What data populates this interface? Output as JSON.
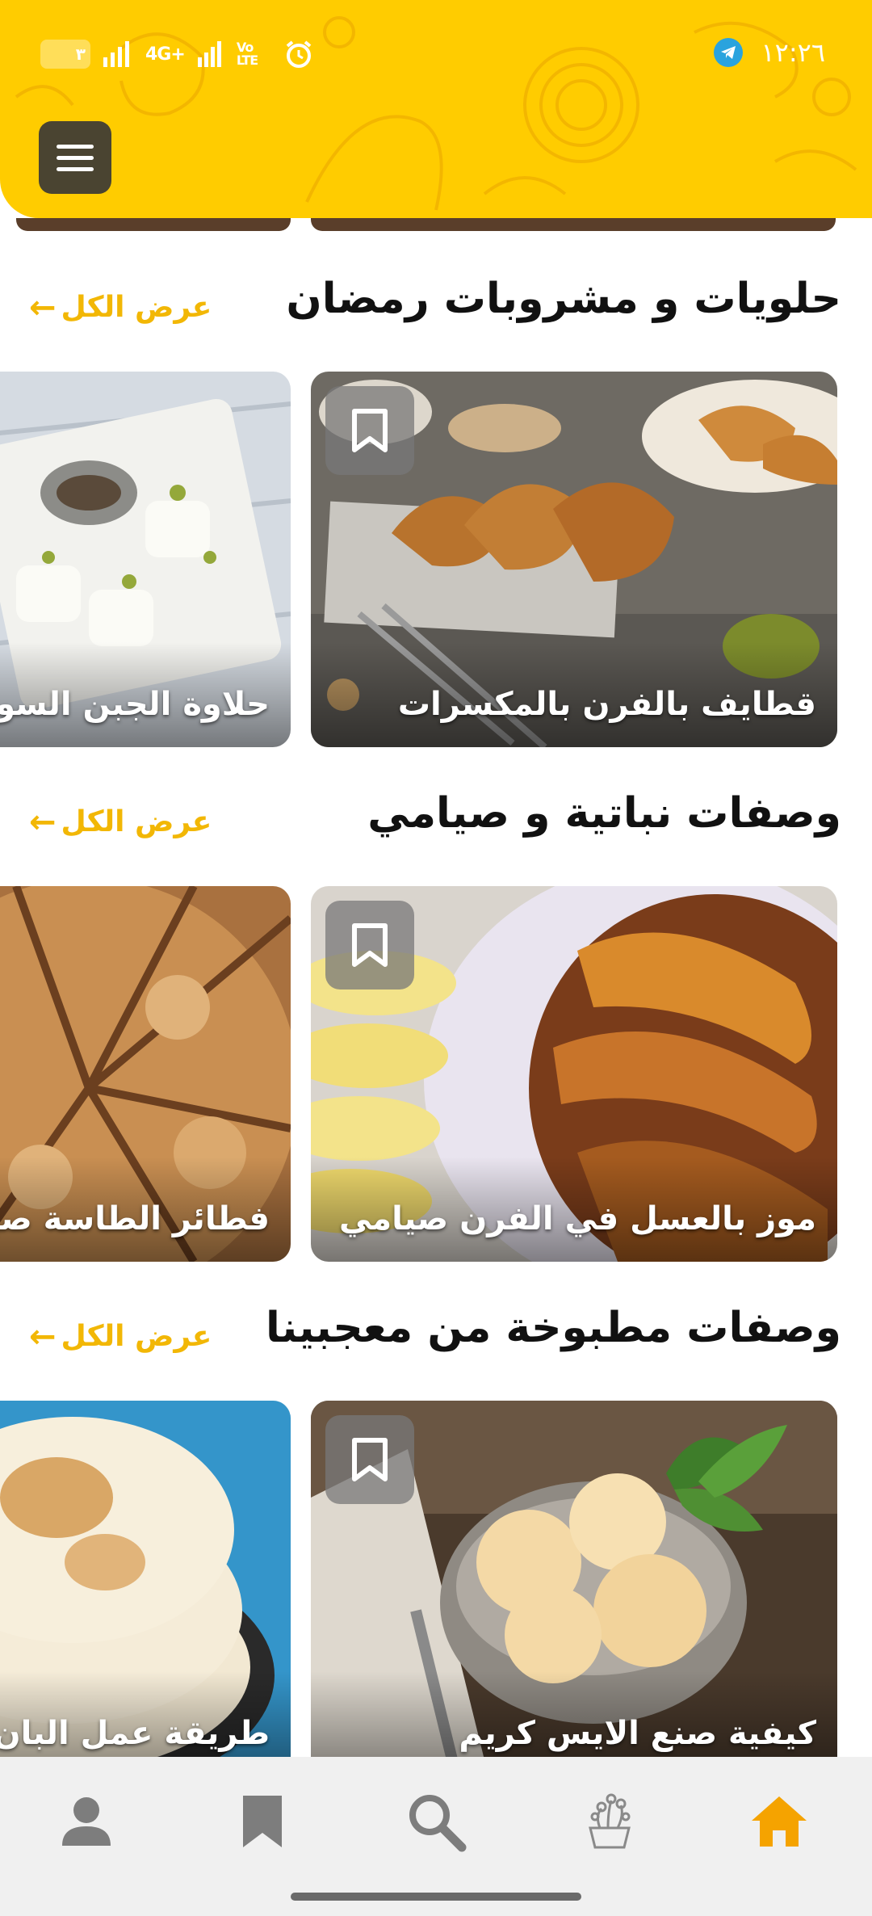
{
  "status_bar": {
    "time": "١٢:٢٦",
    "battery": "٣",
    "network": "4G+",
    "volte": "Vo LTE"
  },
  "sections": [
    {
      "title": "حلويات و مشروبات رمضان",
      "see_all": "عرض الكل",
      "cards": [
        {
          "name": "قطايف بالفرن بالمكسرات"
        },
        {
          "name": "حلاوة الجبن السورية"
        }
      ]
    },
    {
      "title": "وصفات نباتية و صيامي",
      "see_all": "عرض الكل",
      "cards": [
        {
          "name": "موز بالعسل في الفرن صيامي"
        },
        {
          "name": "فطائر الطاسة صيامي"
        }
      ]
    },
    {
      "title": "وصفات مطبوخة من معجبينا",
      "see_all": "عرض الكل",
      "cards": [
        {
          "name": "كيفية صنع الايس كريم"
        },
        {
          "name": "طريقة عمل البان كيك"
        }
      ]
    }
  ],
  "bottom_nav": {
    "items": [
      {
        "icon": "home-icon",
        "active": true
      },
      {
        "icon": "ingredients-icon",
        "active": false
      },
      {
        "icon": "search-icon",
        "active": false
      },
      {
        "icon": "bookmark-icon",
        "active": false
      },
      {
        "icon": "profile-icon",
        "active": false
      }
    ]
  },
  "colors": {
    "header": "#FFCC00",
    "accent": "#F2B705",
    "active_nav": "#F5A300",
    "inactive_nav": "#7d7d7d"
  }
}
